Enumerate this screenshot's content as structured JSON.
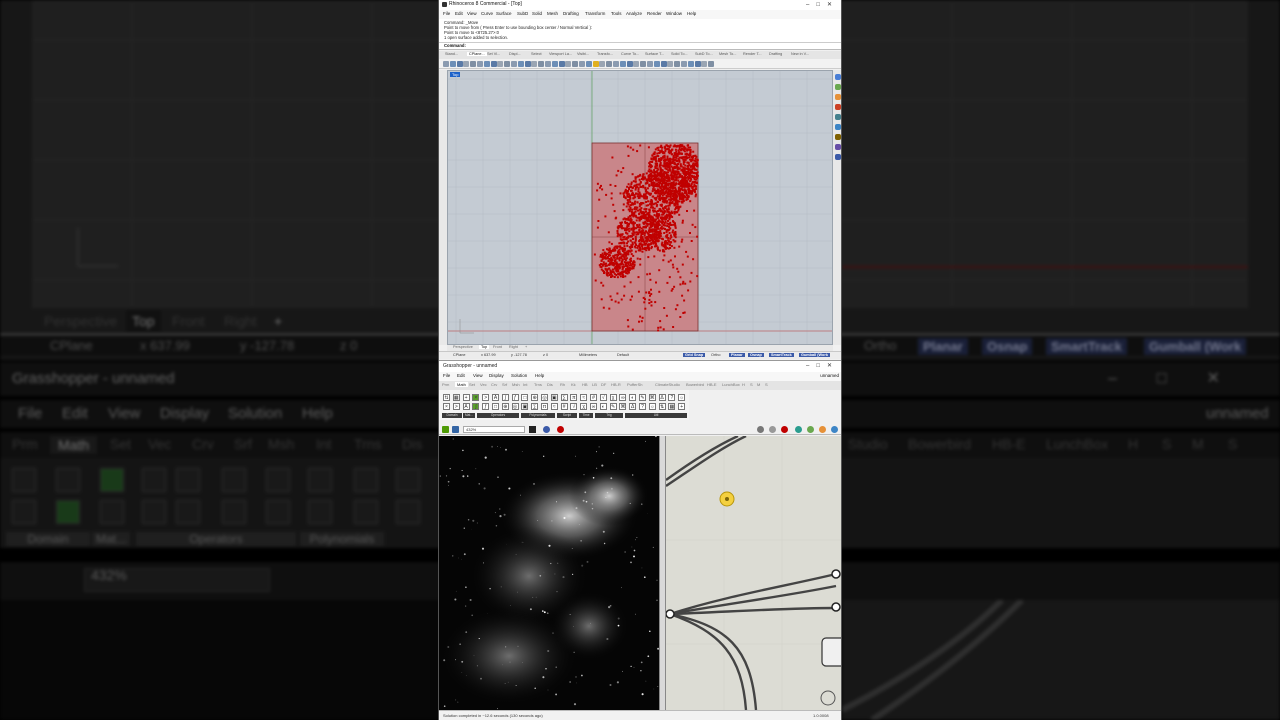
{
  "rhino": {
    "title": "Rhinoceros 8 Commercial - [Top]",
    "menu": [
      "File",
      "Edit",
      "View",
      "Curve",
      "Surface",
      "SubD",
      "Solid",
      "Mesh",
      "Drafting",
      "Transform",
      "Tools",
      "Analyze",
      "Render",
      "Window",
      "Help"
    ],
    "command_history": [
      "Command: _Move",
      "Point to move from ( Press Enter to use bounding box center / Normal  Vertical ):",
      "Point to move to <8725.27>:0",
      "1 open surface added to selection."
    ],
    "command_prompt": "Command:",
    "toolbar_tabs": [
      "Stand...",
      "CPlane...",
      "Set Vi...",
      "Displ...",
      "Select",
      "Viewport La...",
      "Visibi...",
      "Transfo...",
      "Curve To...",
      "Surface T...",
      "Solid To...",
      "SubD To...",
      "Mesh To...",
      "Render T...",
      "Drafting",
      "New in V..."
    ],
    "active_toolbar_tab": "CPlane...",
    "viewport_label": "Top",
    "viewport_tabs": [
      "Perspective",
      "Top",
      "Front",
      "Right"
    ],
    "active_viewport_tab": "Top",
    "status": {
      "cplane": "CPlane",
      "x": "x 637.99",
      "y": "y -127.78",
      "z": "z 0",
      "units": "Millimeters",
      "layer": "Default",
      "buttons": [
        "Grid Snap",
        "Ortho",
        "Planar",
        "Osnap",
        "SmartTrack",
        "Gumball (Work"
      ]
    }
  },
  "grasshopper": {
    "title": "Grasshopper - unnamed",
    "doc_name": "unnamed",
    "menu": [
      "File",
      "Edit",
      "View",
      "Display",
      "Solution",
      "Help"
    ],
    "tabs": [
      "Prm",
      "Math",
      "Set",
      "Vec",
      "Crv",
      "Srf",
      "Msh",
      "Int",
      "Trns",
      "Dis",
      "Rh",
      "Kk",
      "HB",
      "LB",
      "DF",
      "HB-R",
      "PufferSh",
      "ClimateStudio",
      "Bowerbird",
      "HB-E",
      "LunchBox",
      "H",
      "S",
      "M",
      "S"
    ],
    "active_tab": "Math",
    "ribbon_groups": [
      "Domain",
      "Mat...",
      "Operators",
      "Polynomials",
      "Script",
      "Time",
      "Trig",
      "Util"
    ],
    "zoom": "432%",
    "status_message": "Solution completed in ~12.6 seconds (130 seconds ago)",
    "version": "1.0.0008"
  },
  "background": {
    "viewport_tabs": [
      "Perspective",
      "Top",
      "Front",
      "Right",
      "+"
    ],
    "status": [
      "CPlane",
      "x 637.99",
      "y -127.78",
      "z 0"
    ],
    "right_buttons": [
      "Ortho",
      "Planar",
      "Osnap",
      "SmartTrack",
      "Gumball (Work"
    ],
    "gh_title": "Grasshopper - unnamed",
    "gh_menu": [
      "File",
      "Edit",
      "View",
      "Display",
      "Solution",
      "Help"
    ],
    "gh_tabs": [
      "Prm",
      "Math",
      "Set",
      "Vec",
      "Crv",
      "Srf",
      "Msh",
      "Int",
      "Trns",
      "Dis"
    ],
    "gh_tabs_right": [
      "Studio",
      "Bowerbird",
      "HB-E",
      "LunchBox",
      "H",
      "S",
      "M",
      "S"
    ],
    "doc_name": "unnamed",
    "ribbon_groups": [
      "Domain",
      "Mat...",
      "Operators",
      "Polynomials"
    ],
    "zoom": "432%"
  },
  "colors": {
    "surface_fill": "#c9868a",
    "cloud_red": "#c00000",
    "accent_blue": "#3b5aa8"
  }
}
